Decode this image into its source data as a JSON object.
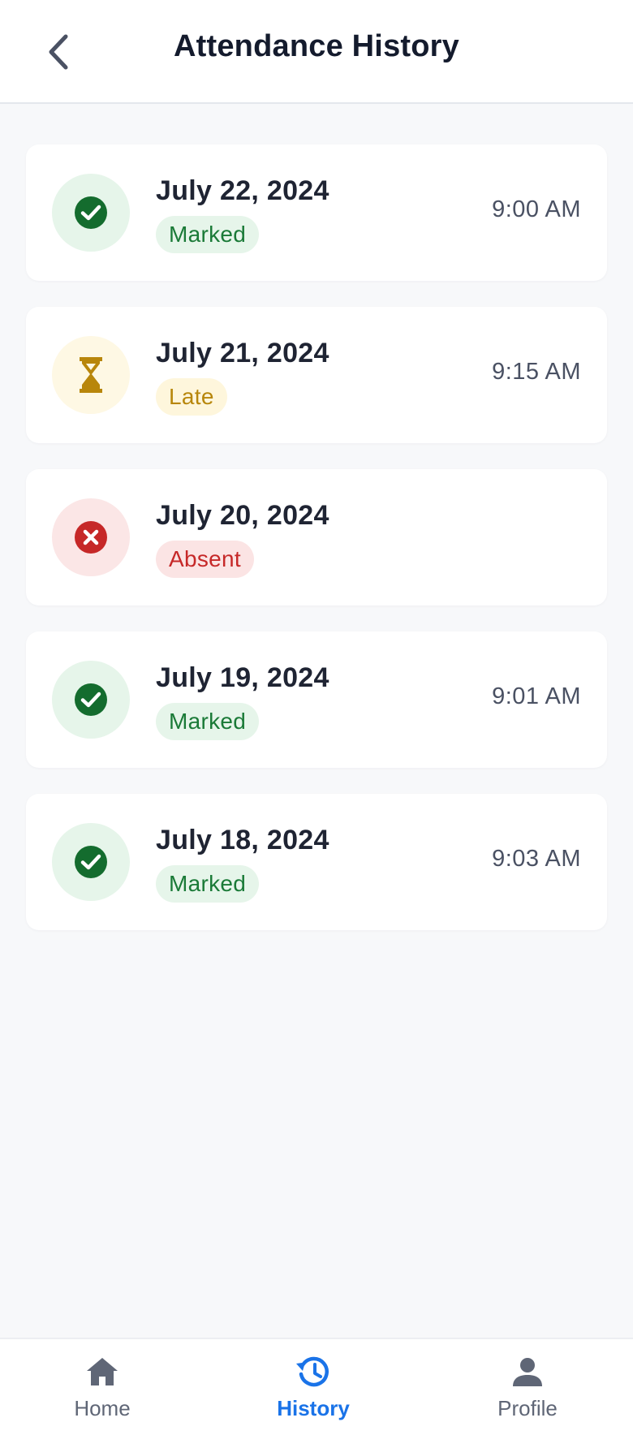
{
  "header": {
    "title": "Attendance History"
  },
  "records": [
    {
      "date": "July 22, 2024",
      "status": "Marked",
      "time": "9:00 AM"
    },
    {
      "date": "July 21, 2024",
      "status": "Late",
      "time": "9:15 AM"
    },
    {
      "date": "July 20, 2024",
      "status": "Absent",
      "time": ""
    },
    {
      "date": "July 19, 2024",
      "status": "Marked",
      "time": "9:01 AM"
    },
    {
      "date": "July 18, 2024",
      "status": "Marked",
      "time": "9:03 AM"
    }
  ],
  "status_styles": {
    "Marked": {
      "icon": "check-circle-icon",
      "icon_bg": "#e6f5ea",
      "icon_color": "#146c2e",
      "badge_bg": "#e6f5ea",
      "badge_text": "#1a7a37"
    },
    "Late": {
      "icon": "hourglass-icon",
      "icon_bg": "#fef8e4",
      "icon_color": "#b8860b",
      "badge_bg": "#fef6dc",
      "badge_text": "#b7860b"
    },
    "Absent": {
      "icon": "x-circle-icon",
      "icon_bg": "#fbe6e6",
      "icon_color": "#c62828",
      "badge_bg": "#fbe4e4",
      "badge_text": "#c62828"
    }
  },
  "tabbar": {
    "active": "History",
    "active_color": "#1a73e8",
    "inactive_color": "#5f6676",
    "tabs": [
      {
        "label": "Home",
        "icon": "home-icon"
      },
      {
        "label": "History",
        "icon": "history-icon"
      },
      {
        "label": "Profile",
        "icon": "person-icon"
      }
    ]
  }
}
